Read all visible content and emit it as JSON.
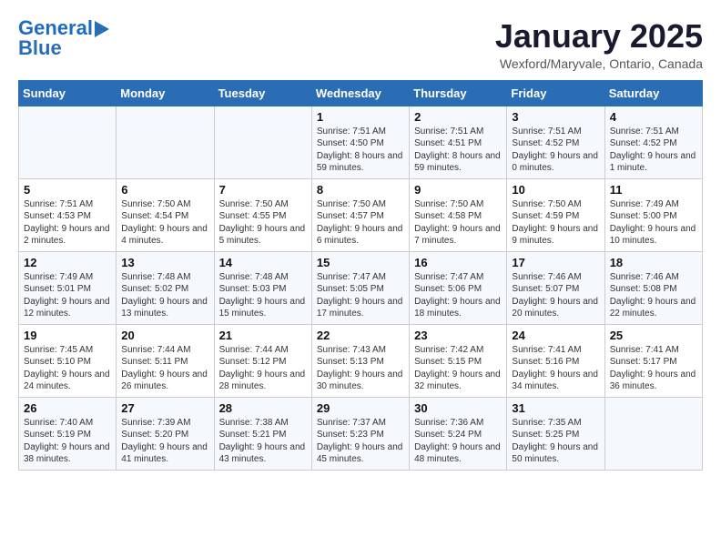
{
  "header": {
    "logo_line1": "General",
    "logo_line2": "Blue",
    "month": "January 2025",
    "location": "Wexford/Maryvale, Ontario, Canada"
  },
  "days_of_week": [
    "Sunday",
    "Monday",
    "Tuesday",
    "Wednesday",
    "Thursday",
    "Friday",
    "Saturday"
  ],
  "weeks": [
    [
      {
        "day": "",
        "info": ""
      },
      {
        "day": "",
        "info": ""
      },
      {
        "day": "",
        "info": ""
      },
      {
        "day": "1",
        "info": "Sunrise: 7:51 AM\nSunset: 4:50 PM\nDaylight: 8 hours and 59 minutes."
      },
      {
        "day": "2",
        "info": "Sunrise: 7:51 AM\nSunset: 4:51 PM\nDaylight: 8 hours and 59 minutes."
      },
      {
        "day": "3",
        "info": "Sunrise: 7:51 AM\nSunset: 4:52 PM\nDaylight: 9 hours and 0 minutes."
      },
      {
        "day": "4",
        "info": "Sunrise: 7:51 AM\nSunset: 4:52 PM\nDaylight: 9 hours and 1 minute."
      }
    ],
    [
      {
        "day": "5",
        "info": "Sunrise: 7:51 AM\nSunset: 4:53 PM\nDaylight: 9 hours and 2 minutes."
      },
      {
        "day": "6",
        "info": "Sunrise: 7:50 AM\nSunset: 4:54 PM\nDaylight: 9 hours and 4 minutes."
      },
      {
        "day": "7",
        "info": "Sunrise: 7:50 AM\nSunset: 4:55 PM\nDaylight: 9 hours and 5 minutes."
      },
      {
        "day": "8",
        "info": "Sunrise: 7:50 AM\nSunset: 4:57 PM\nDaylight: 9 hours and 6 minutes."
      },
      {
        "day": "9",
        "info": "Sunrise: 7:50 AM\nSunset: 4:58 PM\nDaylight: 9 hours and 7 minutes."
      },
      {
        "day": "10",
        "info": "Sunrise: 7:50 AM\nSunset: 4:59 PM\nDaylight: 9 hours and 9 minutes."
      },
      {
        "day": "11",
        "info": "Sunrise: 7:49 AM\nSunset: 5:00 PM\nDaylight: 9 hours and 10 minutes."
      }
    ],
    [
      {
        "day": "12",
        "info": "Sunrise: 7:49 AM\nSunset: 5:01 PM\nDaylight: 9 hours and 12 minutes."
      },
      {
        "day": "13",
        "info": "Sunrise: 7:48 AM\nSunset: 5:02 PM\nDaylight: 9 hours and 13 minutes."
      },
      {
        "day": "14",
        "info": "Sunrise: 7:48 AM\nSunset: 5:03 PM\nDaylight: 9 hours and 15 minutes."
      },
      {
        "day": "15",
        "info": "Sunrise: 7:47 AM\nSunset: 5:05 PM\nDaylight: 9 hours and 17 minutes."
      },
      {
        "day": "16",
        "info": "Sunrise: 7:47 AM\nSunset: 5:06 PM\nDaylight: 9 hours and 18 minutes."
      },
      {
        "day": "17",
        "info": "Sunrise: 7:46 AM\nSunset: 5:07 PM\nDaylight: 9 hours and 20 minutes."
      },
      {
        "day": "18",
        "info": "Sunrise: 7:46 AM\nSunset: 5:08 PM\nDaylight: 9 hours and 22 minutes."
      }
    ],
    [
      {
        "day": "19",
        "info": "Sunrise: 7:45 AM\nSunset: 5:10 PM\nDaylight: 9 hours and 24 minutes."
      },
      {
        "day": "20",
        "info": "Sunrise: 7:44 AM\nSunset: 5:11 PM\nDaylight: 9 hours and 26 minutes."
      },
      {
        "day": "21",
        "info": "Sunrise: 7:44 AM\nSunset: 5:12 PM\nDaylight: 9 hours and 28 minutes."
      },
      {
        "day": "22",
        "info": "Sunrise: 7:43 AM\nSunset: 5:13 PM\nDaylight: 9 hours and 30 minutes."
      },
      {
        "day": "23",
        "info": "Sunrise: 7:42 AM\nSunset: 5:15 PM\nDaylight: 9 hours and 32 minutes."
      },
      {
        "day": "24",
        "info": "Sunrise: 7:41 AM\nSunset: 5:16 PM\nDaylight: 9 hours and 34 minutes."
      },
      {
        "day": "25",
        "info": "Sunrise: 7:41 AM\nSunset: 5:17 PM\nDaylight: 9 hours and 36 minutes."
      }
    ],
    [
      {
        "day": "26",
        "info": "Sunrise: 7:40 AM\nSunset: 5:19 PM\nDaylight: 9 hours and 38 minutes."
      },
      {
        "day": "27",
        "info": "Sunrise: 7:39 AM\nSunset: 5:20 PM\nDaylight: 9 hours and 41 minutes."
      },
      {
        "day": "28",
        "info": "Sunrise: 7:38 AM\nSunset: 5:21 PM\nDaylight: 9 hours and 43 minutes."
      },
      {
        "day": "29",
        "info": "Sunrise: 7:37 AM\nSunset: 5:23 PM\nDaylight: 9 hours and 45 minutes."
      },
      {
        "day": "30",
        "info": "Sunrise: 7:36 AM\nSunset: 5:24 PM\nDaylight: 9 hours and 48 minutes."
      },
      {
        "day": "31",
        "info": "Sunrise: 7:35 AM\nSunset: 5:25 PM\nDaylight: 9 hours and 50 minutes."
      },
      {
        "day": "",
        "info": ""
      }
    ]
  ]
}
